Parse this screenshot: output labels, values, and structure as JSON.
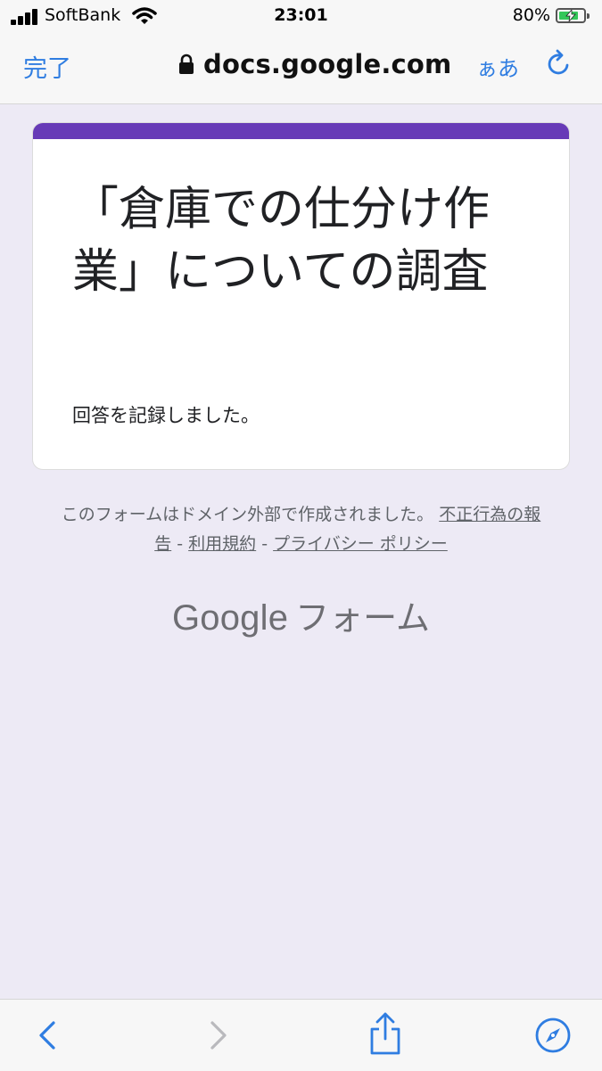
{
  "status_bar": {
    "carrier": "SoftBank",
    "time": "23:01",
    "battery_percent": "80%",
    "battery_level": 0.8,
    "battery_color": "#34c759"
  },
  "browser": {
    "done_label": "完了",
    "address": "docs.google.com",
    "text_size_label": "ぁあ",
    "accent_color": "#2f7de1",
    "icons": [
      "lock-icon",
      "reload-icon",
      "back-icon",
      "forward-icon",
      "share-icon",
      "compass-icon"
    ]
  },
  "form": {
    "title": "「倉庫での仕分け作業」についての調査",
    "confirmation": "回答を記録しました。",
    "accent_color": "#673ab7"
  },
  "footer": {
    "notice": "このフォームはドメイン外部で作成されました。",
    "report_link": "不正行為の報告",
    "separator1": " - ",
    "terms_link": "利用規約",
    "separator2": " - ",
    "privacy_link": "プライバシー ポリシー",
    "brand_google": "Google",
    "brand_forms": "フォーム"
  }
}
